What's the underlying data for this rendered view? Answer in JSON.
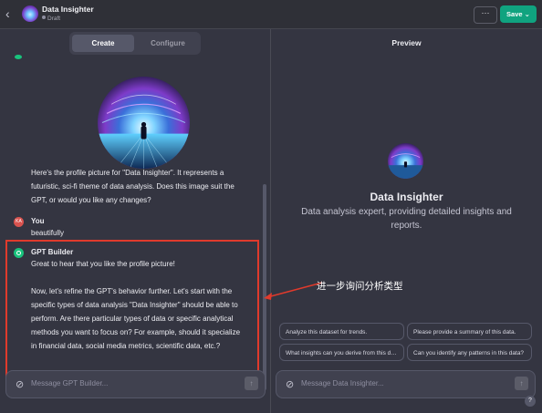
{
  "header": {
    "back_glyph": "‹",
    "title": "Data Insighter",
    "status": "Draft",
    "more_glyph": "···",
    "save_label": "Save ⌄"
  },
  "tabs": [
    {
      "label": "Create",
      "active": true
    },
    {
      "label": "Configure",
      "active": false
    }
  ],
  "chat": {
    "assistant_intro": [
      "Here's the profile picture for \"Data Insighter\". It represents a",
      "futuristic, sci-fi theme of data analysis. Does this image suit the",
      "GPT, or would you like any changes?"
    ],
    "user": {
      "sender": "You",
      "initials": "KA",
      "message": "beautifully"
    },
    "assistant": {
      "sender": "GPT Builder",
      "lines": [
        "Great to hear that you like the profile picture!",
        "",
        "Now, let's refine the GPT's behavior further. Let's start with the",
        "specific types of data analysis \"Data Insighter\" should be able to",
        "perform. Are there particular types of data or specific analytical",
        "methods you want to focus on? For example, should it specialize",
        "in financial data, social media metrics, scientific data, etc.?"
      ]
    },
    "input_placeholder": "Message GPT Builder..."
  },
  "annotation": {
    "text": "进一步询问分析类型",
    "color": "#e03a2c"
  },
  "preview": {
    "title": "Preview",
    "gpt_name": "Data Insighter",
    "description": "Data analysis expert, providing detailed insights and reports.",
    "starters": [
      "Analyze this dataset for trends.",
      "Please provide a summary of this data.",
      "What insights can you derive from this data?",
      "Can you identify any patterns in this data?"
    ],
    "input_placeholder": "Message Data Insighter..."
  },
  "help_label": "?",
  "colors": {
    "accent": "#10a37f",
    "background": "#343541",
    "highlight": "#e03a2c"
  },
  "icons": [
    "chevron-left-icon",
    "attach-icon",
    "send-arrow-icon",
    "help-icon"
  ]
}
